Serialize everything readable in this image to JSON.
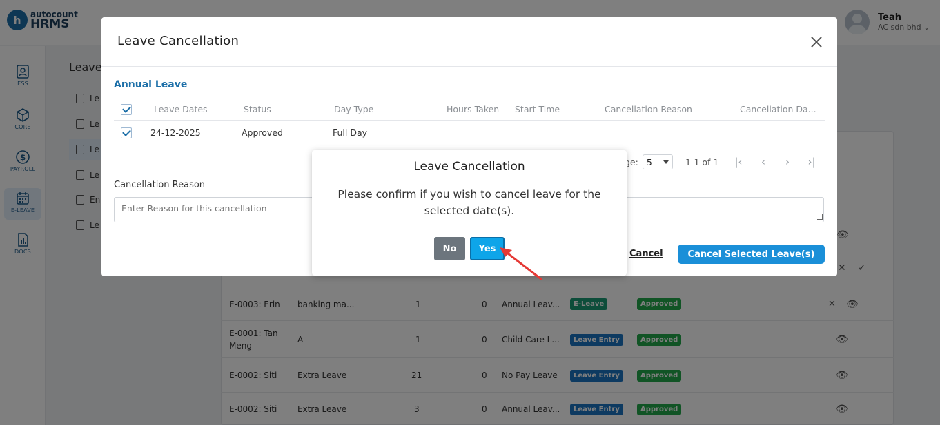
{
  "app": {
    "brand": "autocount",
    "product": "HRMS",
    "logo_letter": "h"
  },
  "user": {
    "name": "Teah",
    "company": "AC sdn bhd"
  },
  "sidebar": {
    "items": [
      {
        "label": "ESS",
        "icon": "ess-icon"
      },
      {
        "label": "CORE",
        "icon": "core-icon"
      },
      {
        "label": "PAYROLL",
        "icon": "payroll-icon"
      },
      {
        "label": "E-LEAVE",
        "icon": "calendar-icon",
        "active": true
      },
      {
        "label": "DOCS",
        "icon": "docs-icon"
      }
    ]
  },
  "page": {
    "title": "Leave",
    "leftnav": [
      "Le",
      "Le",
      "Le",
      "Le",
      "En",
      "Le"
    ]
  },
  "background_table": {
    "rows": [
      {
        "employee": "E-0003: Erin",
        "reason": "banking ma...",
        "days": "1",
        "hours": "0",
        "leave_type": "Annual Leav...",
        "source": "E-Leave",
        "status": "Approved"
      },
      {
        "employee": "E-0001: Tan Meng",
        "reason": "A",
        "days": "1",
        "hours": "0",
        "leave_type": "Child Care L...",
        "source": "Leave Entry",
        "status": "Approved"
      },
      {
        "employee": "E-0002: Siti",
        "reason": "Extra Leave",
        "days": "21",
        "hours": "0",
        "leave_type": "No Pay Leave",
        "source": "Leave Entry",
        "status": "Approved"
      },
      {
        "employee": "E-0002: Siti",
        "reason": "Extra Leave",
        "days": "3",
        "hours": "0",
        "leave_type": "Annual Leav...",
        "source": "Leave Entry",
        "status": "Approved"
      }
    ]
  },
  "modal": {
    "title": "Leave Cancellation",
    "section_title": "Annual Leave",
    "columns": [
      "Leave Dates",
      "Status",
      "Day Type",
      "Hours Taken",
      "Start Time",
      "Cancellation Reason",
      "Cancellation Da..."
    ],
    "rows": [
      {
        "checked": true,
        "leave_date": "24-12-2025",
        "status": "Approved",
        "day_type": "Full Day",
        "hours_taken": "",
        "start_time": "",
        "cancellation_reason": "",
        "cancellation_date": ""
      }
    ],
    "pagination": {
      "rows_per_page_label": "ge:",
      "rows_per_page": "5",
      "range": "1-1 of 1"
    },
    "reason_label": "Cancellation Reason",
    "reason_placeholder": "Enter Reason for this cancellation",
    "cancel_label": "Cancel",
    "cancel_selected_label": "Cancel Selected Leave(s)"
  },
  "confirm_dialog": {
    "title": "Leave Cancellation",
    "message": "Please confirm if you wish to cancel leave for the selected date(s).",
    "no_label": "No",
    "yes_label": "Yes"
  },
  "colors": {
    "primary": "#1a8fd8",
    "yes_button": "#0ea5e9",
    "no_button": "#6c757d",
    "arrow": "#e53935",
    "badge_blue": "#1a75c2",
    "badge_green": "#22a94a"
  }
}
